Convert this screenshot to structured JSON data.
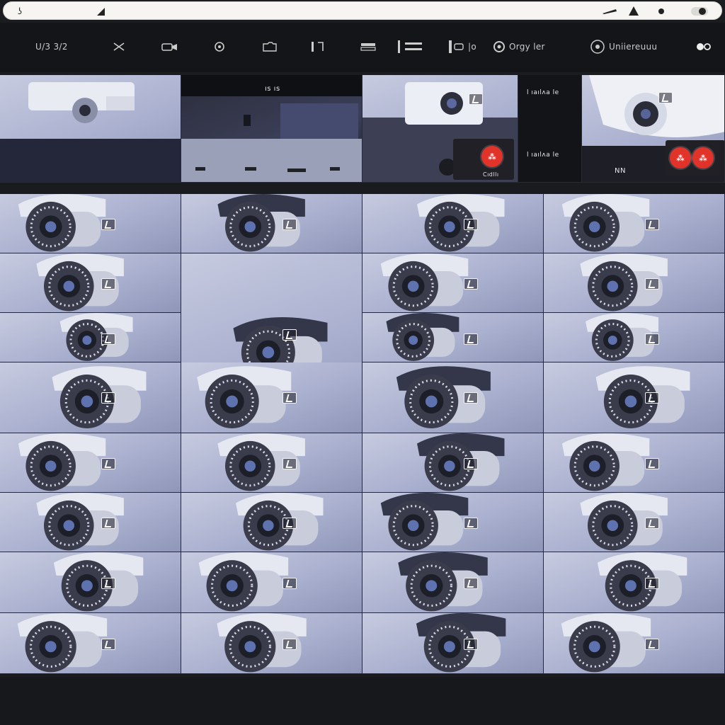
{
  "browser": {
    "left_icon": "ʖ",
    "icons": [
      "cursor-icon",
      "pen-icon",
      "triangle-icon",
      "dot-icon",
      "toggle-icon"
    ]
  },
  "toolbar": {
    "items": [
      {
        "name": "layout-button",
        "label": "U/3 3/2",
        "icon": "grid-icon"
      },
      {
        "name": "close-button",
        "label": "",
        "icon": "close-icon"
      },
      {
        "name": "camera-button",
        "label": "",
        "icon": "camera-icon"
      },
      {
        "name": "record-button",
        "label": "",
        "icon": "record-icon"
      },
      {
        "name": "snapshot-button",
        "label": "",
        "icon": "snapshot-icon"
      },
      {
        "name": "split-button",
        "label": "",
        "icon": "split-icon"
      },
      {
        "name": "storage-button",
        "label": "",
        "icon": "storage-icon"
      },
      {
        "name": "list-button",
        "label": "",
        "icon": "list-icon"
      },
      {
        "name": "playback-button",
        "label": "|o",
        "icon": "playback-icon"
      },
      {
        "name": "settings-button",
        "label": "Orgy  ler  ",
        "icon": "settings-icon"
      },
      {
        "name": "unmanaged-button",
        "label": "Uniiereuuu",
        "icon": "eye-icon"
      },
      {
        "name": "more-button",
        "label": "",
        "icon": "more-icon"
      }
    ]
  },
  "top_row": {
    "feed_label": "ıs ıs",
    "alert_texts": [
      "l ıaılʌa le",
      "l ıaılʌa le"
    ],
    "alert_button_label": "⁂",
    "alert_caption": "Cıdllı",
    "corner_label": "NN"
  },
  "accent_color": "#e2332b",
  "grid": {
    "columns": 4,
    "rows_label": "camera-tiles"
  }
}
